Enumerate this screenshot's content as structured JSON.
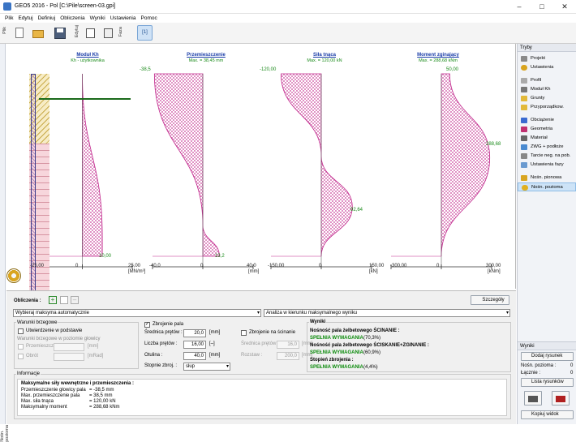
{
  "window": {
    "title": "GEO5 2016 - Pol [C:\\Pile\\screen-03.gpi]"
  },
  "menu": [
    "Plik",
    "Edytuj",
    "Definiuj",
    "Obliczenia",
    "Wyniki",
    "Ustawienia",
    "Pomoc"
  ],
  "toolbar": {
    "plik_label": "Plik",
    "edytuj_label": "Edytuj",
    "faza_label": "Faza"
  },
  "charts": [
    {
      "title": "Moduł Kh",
      "subtitle": "Kh - użytkownika",
      "ticks": [
        "-25,00",
        "0",
        "25,00"
      ],
      "unit": "[MN/m³]",
      "top_value": "",
      "value_label": "10,00"
    },
    {
      "title": "Przemieszczenie",
      "subtitle": "Max. = 38,45 mm",
      "ticks": [
        "-40,0",
        "0",
        "40,0"
      ],
      "unit": "[mm]",
      "top_value": "-38,5",
      "value_label": "13,2"
    },
    {
      "title": "Siła tnąca",
      "subtitle": "Max. = 120,00 kN",
      "ticks": [
        "-150,00",
        "0",
        "150,00"
      ],
      "unit": "[kN]",
      "top_value": "-120,00",
      "value_label": "92,64"
    },
    {
      "title": "Moment zginający",
      "subtitle": "Max. = 288,68 kNm",
      "ticks": [
        "-300,00",
        "0",
        "300,00"
      ],
      "unit": "[kNm]",
      "top_value": "50,00",
      "value_label": "288,68"
    }
  ],
  "chart_data": [
    {
      "type": "area",
      "title": "Moduł Kh",
      "subtitle": "Kh - użytkownika",
      "x": [
        0,
        10.0,
        10.0
      ],
      "y_depth_frac": [
        0,
        0.9,
        1.0
      ],
      "xlim": [
        -25,
        25
      ],
      "xlabel": "[MN/m³]",
      "annotations": [
        "10,00"
      ]
    },
    {
      "type": "area",
      "title": "Przemieszczenie",
      "subtitle": "Max. = 38,45 mm",
      "x": [
        -38.5,
        0,
        13.2
      ],
      "y_depth_frac": [
        0,
        0.83,
        1.0
      ],
      "xlim": [
        -40,
        40
      ],
      "xlabel": "[mm]",
      "annotations": [
        "-38,5",
        "13,2"
      ]
    },
    {
      "type": "area",
      "title": "Siła tnąca",
      "subtitle": "Max. = 120,00 kN",
      "x": [
        -120.0,
        0,
        92.64,
        0
      ],
      "y_depth_frac": [
        0,
        0.45,
        0.73,
        1.0
      ],
      "xlim": [
        -150,
        150
      ],
      "xlabel": "[kN]",
      "annotations": [
        "-120,00",
        "92,64"
      ]
    },
    {
      "type": "area",
      "title": "Moment zginający",
      "subtitle": "Max. = 288,68 kNm",
      "x": [
        50.0,
        288.68,
        0
      ],
      "y_depth_frac": [
        0,
        0.46,
        1.0
      ],
      "xlim": [
        -300,
        300
      ],
      "xlabel": "[kNm]",
      "annotations": [
        "50,00",
        "288,68"
      ]
    }
  ],
  "right_panel": {
    "head": "Tryby",
    "items": [
      "Projekt",
      "Ustawienia",
      "Profil",
      "Moduł Kh",
      "Grunty",
      "Przyporządkow.",
      "Obciążenie",
      "Geometria",
      "Materiał",
      "ZWG + podłoże",
      "Tarcie neg. na pob.",
      "Ustawienia fazy",
      "Nośn. pionowa",
      "Nośn. pozioma"
    ],
    "wyniki_head": "Wyniki",
    "dodaj_rysunek": "Dodaj rysunek",
    "nosn_pozioma_label": "Nośn. pozioma :",
    "nosn_pozioma_val": "0",
    "lacznie_label": "Łącznie :",
    "lacznie_val": "0",
    "lista_rysunkow": "Lista rysunków",
    "kopiuj_widok": "Kopiuj widok"
  },
  "bottom": {
    "obliczenia_label": "Obliczenia :",
    "szczegoly_label": "Szczegóły",
    "select1": "Wybieraj maksyma automatycznie",
    "select2": "Analiza w kierunku maksymalnego wyniku",
    "warunki_title": "Warunki brzegowe",
    "utwierdzenie_label": "Utwierdzenie w podstawie",
    "warunki_gl_title": "Warunki brzegowe w poziomie głowicy",
    "przemieszcz_label": "Przemieszcz.",
    "przemieszcz_unit": "[mm]",
    "obrot_label": "Obrót",
    "obrot_unit": "[mRad]",
    "zbrojenie_label": "Zbrojenie pala",
    "srednica_pretow_label": "Średnica prętów :",
    "srednica_pretow_val": "20,0",
    "srednica_pretow_unit": "[mm]",
    "liczba_pretow_label": "Liczba prętów :",
    "liczba_pretow_val": "16,00",
    "liczba_pretow_unit": "[–]",
    "otulina_label": "Otulina :",
    "otulina_val": "40,0",
    "otulina_unit": "[mm]",
    "stopien_label": "Stopnie zbroj. :",
    "stopien_val": "słup",
    "zbrojenie_scinanie_label": "Zbrojenie na ścinanie",
    "srednica_strzem_label": "Średnica prętów :",
    "srednica_strzem_val": "16,0",
    "srednica_strzem_unit": "[mm]",
    "rozstaw_label": "Rozstaw :",
    "rozstaw_val": "200,0",
    "rozstaw_unit": "[mm]",
    "wyniki_title": "Wyniki",
    "wyniki_lines": [
      {
        "label": "Nośność pala żelbetowego ŚCINANIE :",
        "bold": true,
        "green": false,
        "pct": ""
      },
      {
        "label": "SPEŁNIA WYMAGANIA",
        "bold": true,
        "green": true,
        "pct": "(70,3%)"
      },
      {
        "label": "Nośność pala żelbetowego ŚCISKANIE+ZGINANIE :",
        "bold": true,
        "green": false,
        "pct": ""
      },
      {
        "label": "SPEŁNIA WYMAGANIA",
        "bold": true,
        "green": true,
        "pct": "(60,9%)"
      },
      {
        "label": "Stopień zbrojenia :",
        "bold": true,
        "green": false,
        "pct": ""
      },
      {
        "label": "SPEŁNIA WYMAGANIA",
        "bold": true,
        "green": true,
        "pct": "(4,4%)"
      }
    ],
    "informacje_title": "Informacje",
    "info_head": "Maksymalne siły wewnętrzne i przemieszczenia :",
    "info_rows": [
      {
        "label": "Przemieszczenie głowicy pala",
        "val": "=   -38,5  mm"
      },
      {
        "label": "Max. przemieszczenie pala",
        "val": "=    38,5  mm"
      },
      {
        "label": "Max. siła tnąca",
        "val": "=  120,00  kN"
      },
      {
        "label": "Maksymalny moment",
        "val": "=  288,68  kNm"
      }
    ],
    "side_label": "Nośn. pozioma"
  },
  "colors": {
    "hatch": "#c0238a",
    "title_blue": "#1a3da8",
    "value_green": "#1a8a1a",
    "ok_green": "#0a8a0a"
  }
}
